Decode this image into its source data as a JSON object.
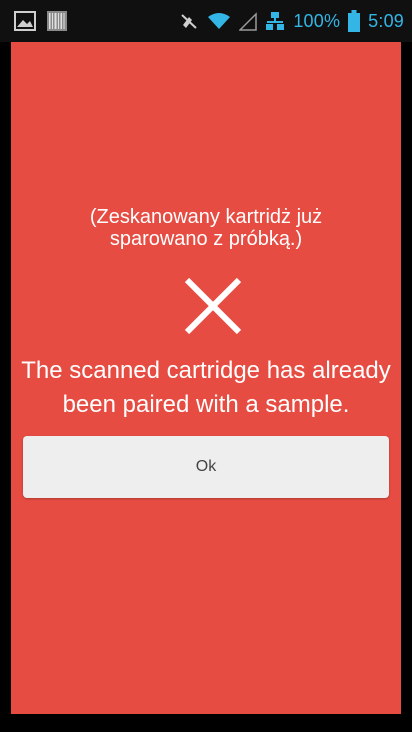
{
  "status_bar": {
    "battery_percent": "100%",
    "time": "5:09",
    "icons": [
      "gallery-icon",
      "barcode-icon",
      "mute-icon",
      "wifi-icon",
      "signal-icon",
      "network-icon",
      "battery-icon"
    ],
    "accent_color": "#33b5e5"
  },
  "dialog": {
    "background_color": "#e64c42",
    "polish_message": "(Zeskanowany kartridż już\nsparowano z próbką.)",
    "error_icon": "close-x-icon",
    "english_message": "The scanned cartridge has already\nbeen paired with a sample.",
    "ok_label": "Ok"
  }
}
